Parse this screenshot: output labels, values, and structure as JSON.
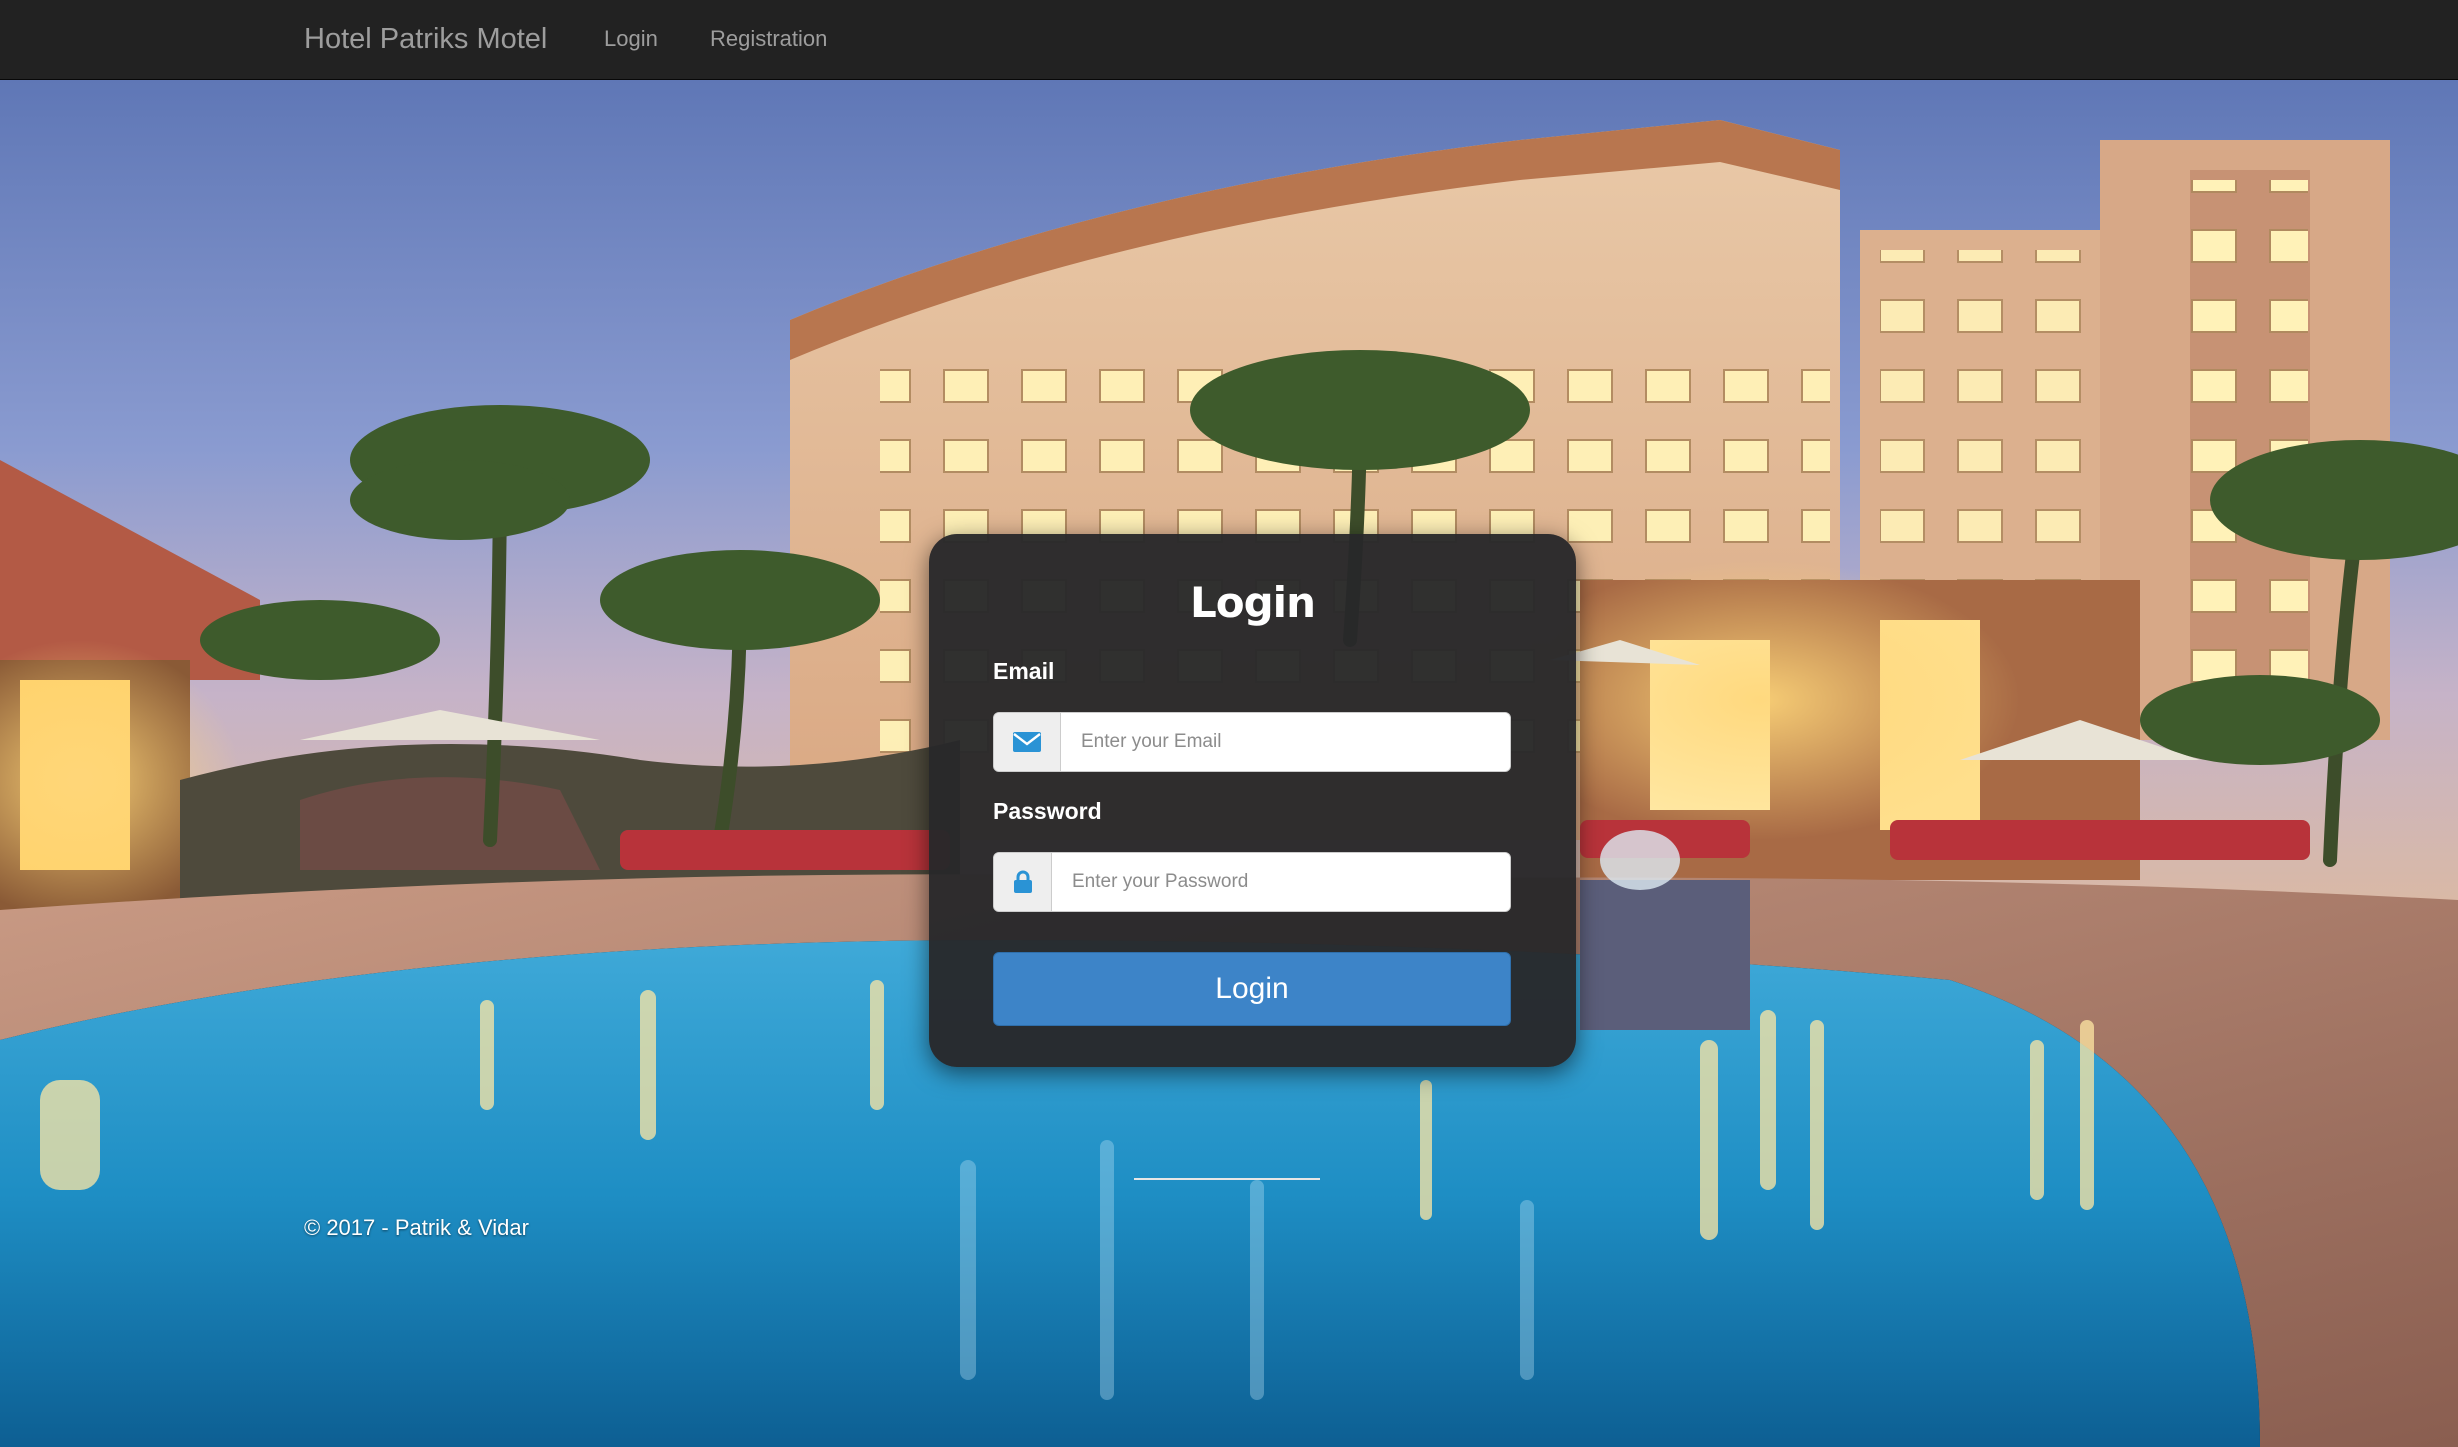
{
  "navbar": {
    "brand": "Hotel Patriks Motel",
    "links": [
      {
        "label": "Login"
      },
      {
        "label": "Registration"
      }
    ]
  },
  "login_form": {
    "title": "Login",
    "email": {
      "label": "Email",
      "placeholder": "Enter your Email",
      "value": "",
      "icon": "envelope-icon"
    },
    "password": {
      "label": "Password",
      "placeholder": "Enter your Password",
      "value": "",
      "icon": "lock-icon"
    },
    "submit_label": "Login"
  },
  "footer": {
    "copyright": "© 2017 - Patrik & Vidar"
  },
  "colors": {
    "navbar_bg": "#222222",
    "nav_text": "#9d9d9d",
    "card_bg": "#28282a",
    "primary_button": "#3d84c8",
    "icon_accent": "#2a93d5"
  }
}
